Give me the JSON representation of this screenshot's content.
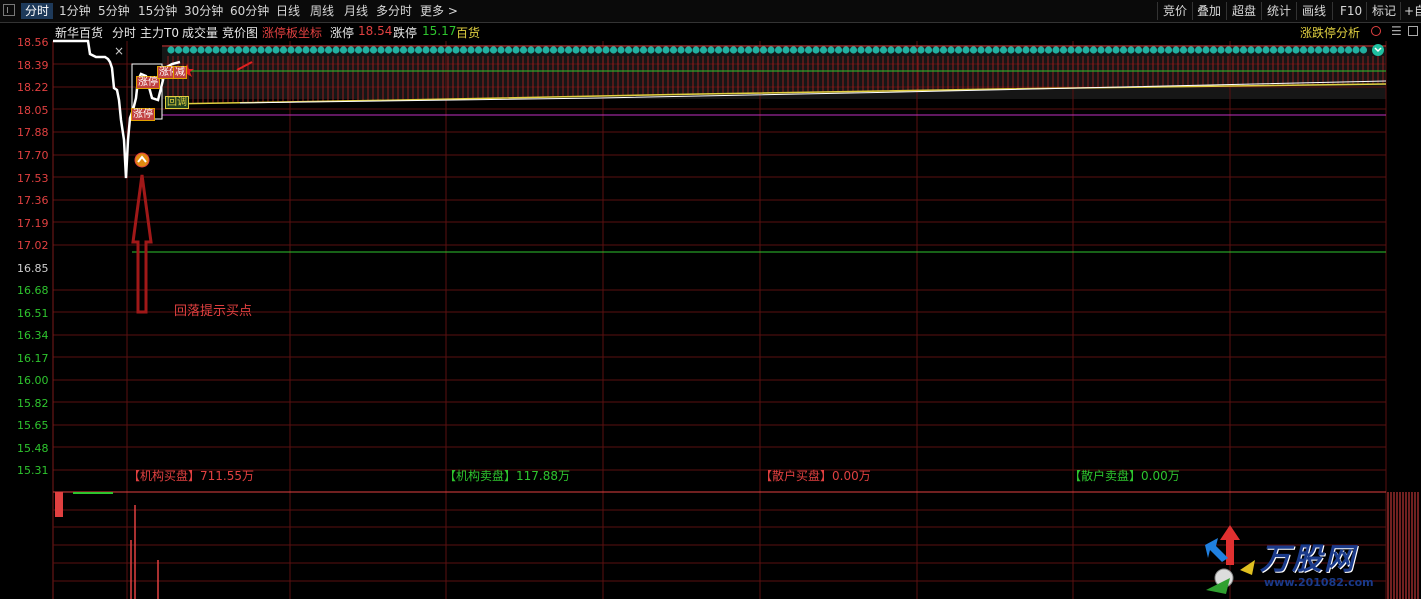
{
  "toolbar": {
    "tabs": [
      "分时",
      "1分钟",
      "5分钟",
      "15分钟",
      "30分钟",
      "60分钟",
      "日线",
      "周线",
      "月线",
      "多分时",
      "更多 >"
    ],
    "right": [
      "竞价",
      "叠加",
      "超盘",
      "统计",
      "画线",
      "F10",
      "标记",
      "+自"
    ]
  },
  "info": {
    "stock": "新华百货",
    "items": [
      "分时",
      "主力T0",
      "成交量",
      "竞价图"
    ],
    "indicator": "涨停板坐标",
    "limit_up_label": "涨停",
    "limit_up_value": "18.54",
    "limit_down_label": "跌停",
    "limit_down_value": "15.17",
    "limit_down_name": "百货",
    "right_label": "涨跌停分析"
  },
  "yaxis": {
    "labels": [
      "18.56",
      "18.39",
      "18.22",
      "18.05",
      "17.88",
      "17.70",
      "17.53",
      "17.36",
      "17.19",
      "17.02",
      "16.85",
      "16.68",
      "16.51",
      "16.34",
      "16.17",
      "16.00",
      "15.82",
      "15.65",
      "15.48",
      "15.31"
    ],
    "prev_close": "16.85"
  },
  "annotation": {
    "buy_hint": "回落提示买点",
    "inst_buy": "【机构买盘】711.55万",
    "inst_sell": "【机构卖盘】117.88万",
    "retail_buy": "【散户买盘】0.00万",
    "retail_sell": "【散户卖盘】0.00万"
  },
  "badges": {
    "zt1": "涨停",
    "zt2": "涨停",
    "zt3": "涨停",
    "jian": "减",
    "hold": "回调"
  },
  "logo": {
    "name": "万股网",
    "url": "www.201082.com"
  },
  "colors": {
    "up": "#e04040",
    "down": "#2ec42e",
    "grid": "#5a1010",
    "price": "#ffffff",
    "avg": "#e0d040"
  }
}
